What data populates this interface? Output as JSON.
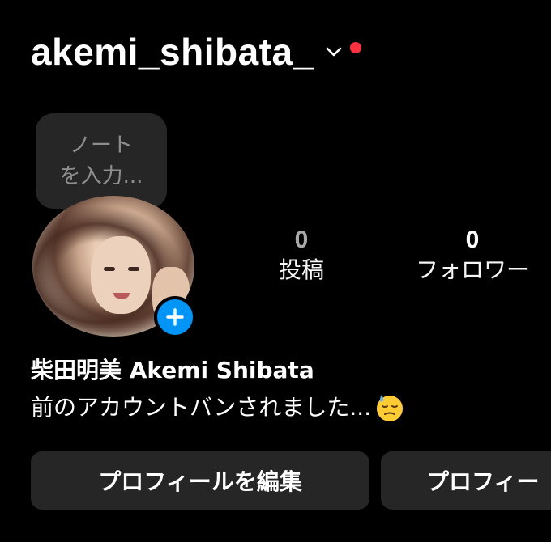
{
  "header": {
    "username": "akemi_shibata_",
    "has_notification_dot": true,
    "colors": {
      "notification_dot": "#ff3040"
    }
  },
  "note": {
    "placeholder": "ノート\nを入力..."
  },
  "note_lines": [
    "ノート",
    "を入力..."
  ],
  "avatar": {
    "icon": "profile-photo"
  },
  "stats": {
    "posts_count": "0",
    "posts_label": "投稿",
    "followers_count": "0",
    "followers_label": "フォロワー"
  },
  "profile": {
    "display_name": "柴田明美 Akemi Shibata",
    "bio": "前のアカウントバンされました...",
    "bio_emoji": "downcast-face-with-sweat"
  },
  "actions": {
    "edit_profile": "プロフィールを編集",
    "share_profile": "プロフィー"
  },
  "colors": {
    "background": "#000000",
    "button_bg": "#262626",
    "accent_blue": "#0095f6",
    "muted_text": "#8e8e8e"
  }
}
